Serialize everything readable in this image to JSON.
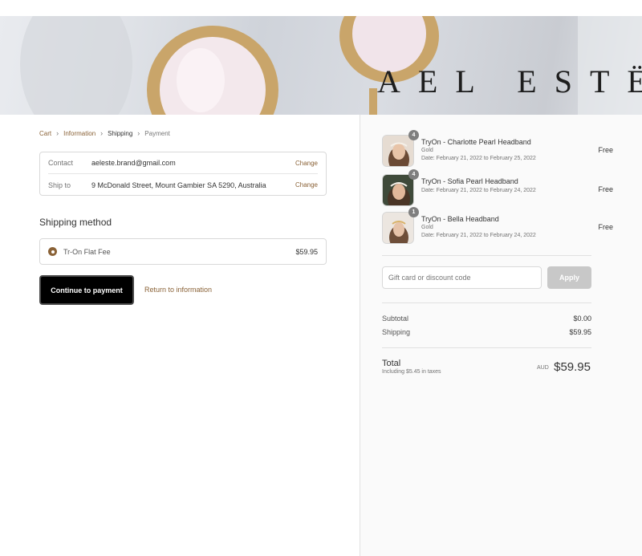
{
  "brand": {
    "name": "AEL ESTË"
  },
  "breadcrumb": [
    {
      "label": "Cart"
    },
    {
      "label": "Information"
    },
    {
      "label": "Shipping"
    },
    {
      "label": "Payment"
    }
  ],
  "review": {
    "contact_label": "Contact",
    "contact_value": "aeleste.brand@gmail.com",
    "ship_label": "Ship to",
    "ship_value": "9 McDonald Street, Mount Gambier SA 5290, Australia",
    "change_label": "Change"
  },
  "shipping": {
    "title": "Shipping method",
    "option_name": "Tr-On Flat Fee",
    "option_price": "$59.95"
  },
  "actions": {
    "continue_label": "Continue to payment",
    "return_label": "Return to information"
  },
  "items": [
    {
      "qty": "4",
      "name": "TryOn - Charlotte Pearl Headband",
      "variant": "Gold",
      "dates": "Date: February 21, 2022 to February 25, 2022",
      "price": "Free"
    },
    {
      "qty": "4",
      "name": "TryOn - Sofia Pearl Headband",
      "variant": "",
      "dates": "Date: February 21, 2022 to February 24, 2022",
      "price": "Free"
    },
    {
      "qty": "1",
      "name": "TryOn - Bella Headband",
      "variant": "Gold",
      "dates": "Date: February 21, 2022 to February 24, 2022",
      "price": "Free"
    }
  ],
  "discount": {
    "placeholder": "Gift card or discount code",
    "apply_label": "Apply"
  },
  "summary": {
    "subtotal_label": "Subtotal",
    "subtotal_value": "$0.00",
    "shipping_label": "Shipping",
    "shipping_value": "$59.95",
    "total_label": "Total",
    "tax_note": "Including $5.45 in taxes",
    "currency": "AUD",
    "total_value": "$59.95"
  },
  "colors": {
    "accent": "#8a6237",
    "button": "#000000",
    "apply_disabled": "#c8c8c8",
    "sidebar_bg": "#fafafa"
  }
}
